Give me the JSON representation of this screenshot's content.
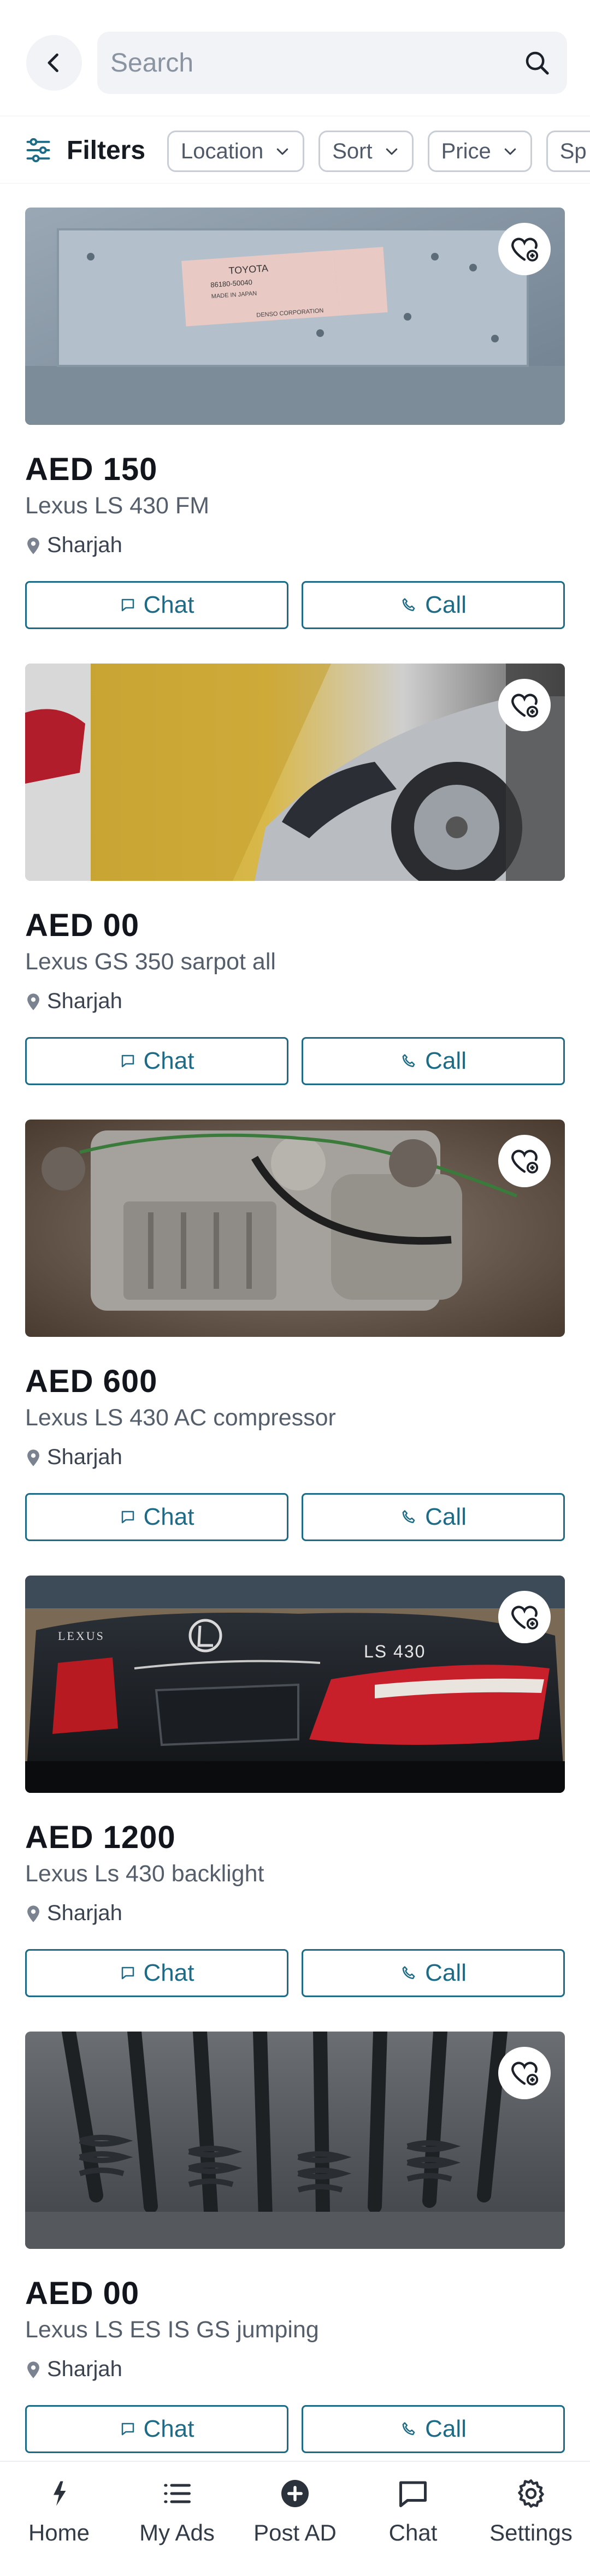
{
  "search": {
    "placeholder": "Search"
  },
  "filters": {
    "label": "Filters",
    "chips": [
      {
        "label": "Location"
      },
      {
        "label": "Sort"
      },
      {
        "label": "Price"
      },
      {
        "label": "Sp"
      }
    ]
  },
  "colors": {
    "accent": "#1d6b86",
    "text": "#12161c",
    "muted": "#555e6b"
  },
  "listings": [
    {
      "price": "AED 150",
      "title": "Lexus LS 430 FM",
      "location": "Sharjah",
      "chat_label": "Chat",
      "call_label": "Call",
      "label_lines": [
        "TOYOTA",
        "86180-50040",
        "MADE IN JAPAN",
        "DENSO CORPORATION"
      ]
    },
    {
      "price": "AED 00",
      "title": "Lexus GS 350 sarpot all",
      "location": "Sharjah",
      "chat_label": "Chat",
      "call_label": "Call"
    },
    {
      "price": "AED 600",
      "title": "Lexus LS 430 AC compressor",
      "location": "Sharjah",
      "chat_label": "Chat",
      "call_label": "Call"
    },
    {
      "price": "AED 1200",
      "title": "Lexus Ls 430 backlight",
      "location": "Sharjah",
      "chat_label": "Chat",
      "call_label": "Call",
      "badges": [
        "LEXUS",
        "LS 430"
      ]
    },
    {
      "price": "AED 00",
      "title": "Lexus LS ES IS GS jumping",
      "location": "Sharjah",
      "chat_label": "Chat",
      "call_label": "Call"
    }
  ],
  "nav": {
    "items": [
      {
        "label": "Home",
        "icon": "home-bolt-icon"
      },
      {
        "label": "My Ads",
        "icon": "list-icon"
      },
      {
        "label": "Post AD",
        "icon": "plus-circle-icon"
      },
      {
        "label": "Chat",
        "icon": "chat-bubble-icon"
      },
      {
        "label": "Settings",
        "icon": "gear-icon"
      }
    ]
  }
}
